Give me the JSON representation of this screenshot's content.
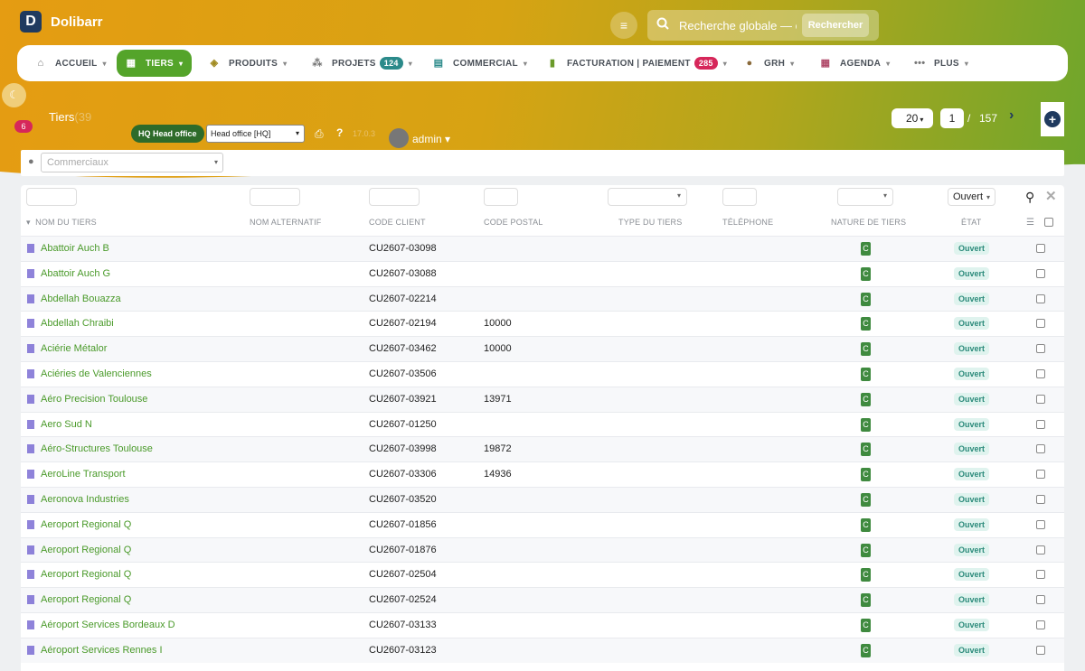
{
  "app": {
    "name": "Dolibarr",
    "logo_letter": "D"
  },
  "global_search": {
    "placeholder": "Recherche globale — c",
    "button": "Rechercher"
  },
  "menu": [
    {
      "label": "ACCUEIL",
      "icon": "home-icon"
    },
    {
      "label": "TIERS",
      "icon": "building-icon",
      "active": true
    },
    {
      "label": "PRODUITS",
      "icon": "cube-icon"
    },
    {
      "label": "PROJETS",
      "icon": "sitemap-icon",
      "badge": "124"
    },
    {
      "label": "COMMERCIAL",
      "icon": "suitcase-icon"
    },
    {
      "label": "FACTURATION | PAIEMENT",
      "icon": "invoice-icon",
      "badge": "285"
    },
    {
      "label": "GRH",
      "icon": "user-tie-icon"
    },
    {
      "label": "AGENDA",
      "icon": "calendar-icon"
    },
    {
      "label": "PLUS",
      "icon": "more-icon"
    }
  ],
  "notifications": {
    "count": "6"
  },
  "page": {
    "title": "Tiers",
    "count": "(39",
    "entity_badge": "HQ Head office",
    "entity_select": "Head office [HQ]",
    "version": "17.0.3",
    "user": "admin"
  },
  "pagination": {
    "per_page": "20",
    "current": "1",
    "sep": "/",
    "total": "157"
  },
  "filters": {
    "commerciaux_placeholder": "Commerciaux",
    "etat_value": "Ouvert"
  },
  "columns": [
    "NOM DU TIERS",
    "NOM ALTERNATIF",
    "CODE CLIENT",
    "CODE POSTAL",
    "TYPE DU TIERS",
    "TÉLÉPHONE",
    "NATURE DE TIERS",
    "ÉTAT"
  ],
  "rows": [
    {
      "name": "Abattoir Auch B",
      "code": "CU2607-03098",
      "zip": "",
      "nature": "C",
      "status": "Ouvert"
    },
    {
      "name": "Abattoir Auch G",
      "code": "CU2607-03088",
      "zip": "",
      "nature": "C",
      "status": "Ouvert"
    },
    {
      "name": "Abdellah Bouazza",
      "code": "CU2607-02214",
      "zip": "",
      "nature": "C",
      "status": "Ouvert"
    },
    {
      "name": "Abdellah Chraibi",
      "code": "CU2607-02194",
      "zip": "10000",
      "nature": "C",
      "status": "Ouvert"
    },
    {
      "name": "Aciérie Métalor",
      "code": "CU2607-03462",
      "zip": "10000",
      "nature": "C",
      "status": "Ouvert"
    },
    {
      "name": "Aciéries de Valenciennes",
      "code": "CU2607-03506",
      "zip": "",
      "nature": "C",
      "status": "Ouvert"
    },
    {
      "name": "Aéro Precision Toulouse",
      "code": "CU2607-03921",
      "zip": "13971",
      "nature": "C",
      "status": "Ouvert"
    },
    {
      "name": "Aero Sud N",
      "code": "CU2607-01250",
      "zip": "",
      "nature": "C",
      "status": "Ouvert"
    },
    {
      "name": "Aéro-Structures Toulouse",
      "code": "CU2607-03998",
      "zip": "19872",
      "nature": "C",
      "status": "Ouvert"
    },
    {
      "name": "AeroLine Transport",
      "code": "CU2607-03306",
      "zip": "14936",
      "nature": "C",
      "status": "Ouvert"
    },
    {
      "name": "Aeronova Industries",
      "code": "CU2607-03520",
      "zip": "",
      "nature": "C",
      "status": "Ouvert"
    },
    {
      "name": "Aeroport Regional Q",
      "code": "CU2607-01856",
      "zip": "",
      "nature": "C",
      "status": "Ouvert"
    },
    {
      "name": "Aeroport Regional Q",
      "code": "CU2607-01876",
      "zip": "",
      "nature": "C",
      "status": "Ouvert"
    },
    {
      "name": "Aeroport Regional Q",
      "code": "CU2607-02504",
      "zip": "",
      "nature": "C",
      "status": "Ouvert"
    },
    {
      "name": "Aeroport Regional Q",
      "code": "CU2607-02524",
      "zip": "",
      "nature": "C",
      "status": "Ouvert"
    },
    {
      "name": "Aéroport Services Bordeaux D",
      "code": "CU2607-03133",
      "zip": "",
      "nature": "C",
      "status": "Ouvert"
    },
    {
      "name": "Aéroport Services Rennes I",
      "code": "CU2607-03123",
      "zip": "",
      "nature": "C",
      "status": "Ouvert"
    }
  ]
}
